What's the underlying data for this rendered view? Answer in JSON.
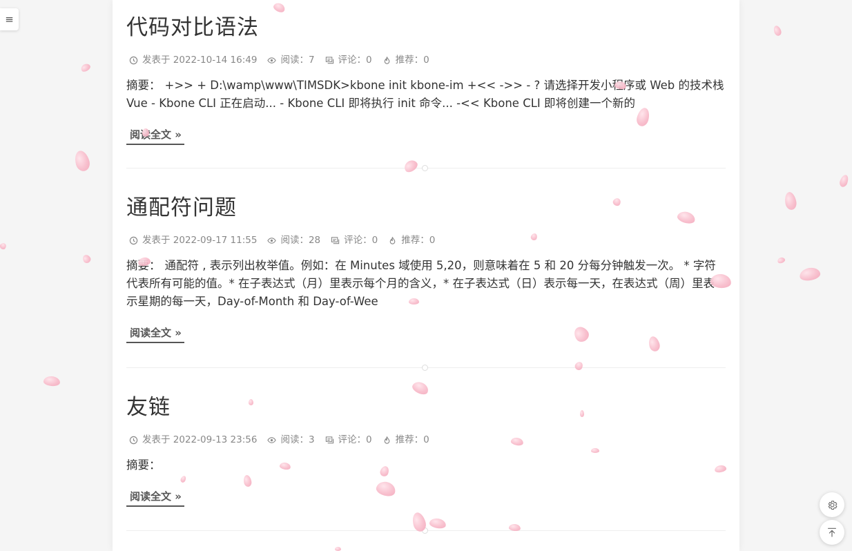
{
  "menu": {
    "icon": "≡"
  },
  "posts": [
    {
      "title": "代码对比语法",
      "date": "发表于 2022-10-14 16:49",
      "reads": "阅读：7",
      "comments": "评论：0",
      "recommend": "推荐：0",
      "summary_label": "摘要：",
      "summary": "+>> + D:\\wamp\\www\\TIMSDK>kbone init kbone-im +<< ->> - ? 请选择开发小程序或 Web 的技术栈 Vue - Kbone CLI 正在启动... - Kbone CLI 即将执行 init 命令... -<< Kbone CLI 即将创建一个新的",
      "read_more": "阅读全文 »"
    },
    {
      "title": "通配符问题",
      "date": "发表于 2022-09-17 11:55",
      "reads": "阅读：28",
      "comments": "评论：0",
      "recommend": "推荐：0",
      "summary_label": "摘要：",
      "summary": "通配符 , 表示列出枚举值。例如：在 Minutes 域使用 5,20，则意味着在 5 和 20 分每分钟触发一次。 * 字符代表所有可能的值。* 在子表达式（月）里表示每个月的含义，* 在子表达式（日）表示每一天，在表达式（周）里表示星期的每一天，Day-of-Month 和 Day-of-Wee",
      "read_more": "阅读全文 »"
    },
    {
      "title": "友链",
      "date": "发表于 2022-09-13 23:56",
      "reads": "阅读：3",
      "comments": "评论：0",
      "recommend": "推荐：0",
      "summary_label": "摘要：",
      "summary": "",
      "read_more": "阅读全文 »"
    }
  ],
  "icons": {
    "clock": "clock-icon",
    "eye": "eye-icon",
    "comment": "comment-icon",
    "flame": "flame-icon",
    "settings": "gear-icon",
    "back_to_top": "back-to-top-icon"
  },
  "colors": {
    "petal": "#f5b3c3",
    "page_bg": "#f5f5f5",
    "card_bg": "#ffffff",
    "text": "#333333",
    "meta": "#888888"
  }
}
